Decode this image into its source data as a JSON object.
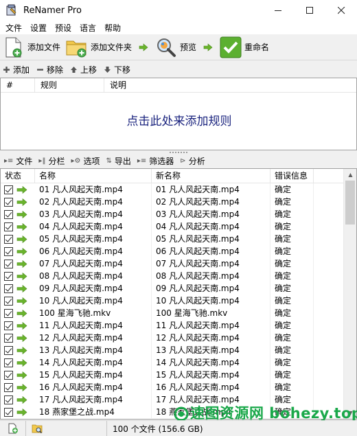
{
  "window": {
    "title": "ReNamer Pro"
  },
  "menu": [
    "文件",
    "设置",
    "预设",
    "语言",
    "帮助"
  ],
  "toolbar": {
    "add_files": "添加文件",
    "add_folder": "添加文件夹",
    "preview": "预览",
    "rename": "重命名"
  },
  "rules_toolbar": {
    "add": "添加",
    "remove": "移除",
    "up": "上移",
    "down": "下移"
  },
  "rules_table": {
    "columns": [
      "#",
      "规则",
      "说明"
    ],
    "empty_text": "点击此处来添加规则"
  },
  "files_toolbar": {
    "files": "文件",
    "columns": "分栏",
    "options": "选项",
    "export": "导出",
    "filters": "筛选器",
    "analyze": "分析"
  },
  "files_table": {
    "columns": [
      "状态",
      "名称",
      "新名称",
      "错误信息"
    ],
    "rows": [
      {
        "name": "01 凡人风起天南.mp4",
        "new_name": "01 凡人风起天南.mp4",
        "error": "确定"
      },
      {
        "name": "02 凡人风起天南.mp4",
        "new_name": "02 凡人风起天南.mp4",
        "error": "确定"
      },
      {
        "name": "03 凡人风起天南.mp4",
        "new_name": "03 凡人风起天南.mp4",
        "error": "确定"
      },
      {
        "name": "04 凡人风起天南.mp4",
        "new_name": "04 凡人风起天南.mp4",
        "error": "确定"
      },
      {
        "name": "05 凡人风起天南.mp4",
        "new_name": "05 凡人风起天南.mp4",
        "error": "确定"
      },
      {
        "name": "06 凡人风起天南.mp4",
        "new_name": "06 凡人风起天南.mp4",
        "error": "确定"
      },
      {
        "name": "07 凡人风起天南.mp4",
        "new_name": "07 凡人风起天南.mp4",
        "error": "确定"
      },
      {
        "name": "08 凡人风起天南.mp4",
        "new_name": "08 凡人风起天南.mp4",
        "error": "确定"
      },
      {
        "name": "09 凡人风起天南.mp4",
        "new_name": "09 凡人风起天南.mp4",
        "error": "确定"
      },
      {
        "name": "10 凡人风起天南.mp4",
        "new_name": "10 凡人风起天南.mp4",
        "error": "确定"
      },
      {
        "name": "100 星海飞驰.mkv",
        "new_name": "100 星海飞驰.mkv",
        "error": "确定"
      },
      {
        "name": "11 凡人风起天南.mp4",
        "new_name": "11 凡人风起天南.mp4",
        "error": "确定"
      },
      {
        "name": "12 凡人风起天南.mp4",
        "new_name": "12 凡人风起天南.mp4",
        "error": "确定"
      },
      {
        "name": "13 凡人风起天南.mp4",
        "new_name": "13 凡人风起天南.mp4",
        "error": "确定"
      },
      {
        "name": "14 凡人风起天南.mp4",
        "new_name": "14 凡人风起天南.mp4",
        "error": "确定"
      },
      {
        "name": "15 凡人风起天南.mp4",
        "new_name": "15 凡人风起天南.mp4",
        "error": "确定"
      },
      {
        "name": "16 凡人风起天南.mp4",
        "new_name": "16 凡人风起天南.mp4",
        "error": "确定"
      },
      {
        "name": "17 凡人风起天南.mp4",
        "new_name": "17 凡人风起天南.mp4",
        "error": "确定"
      },
      {
        "name": "18 燕家堡之战.mp4",
        "new_name": "18 燕家堡之战.mp4",
        "error": "确定"
      }
    ]
  },
  "statusbar": {
    "file_count": "100 个文件 (156.6 GB)"
  },
  "watermark": {
    "text": "速图资源网 bohezy.top"
  },
  "colors": {
    "accent_green": "#6ab42c",
    "rule_text": "#1a237e",
    "watermark": "#1aa84a"
  }
}
